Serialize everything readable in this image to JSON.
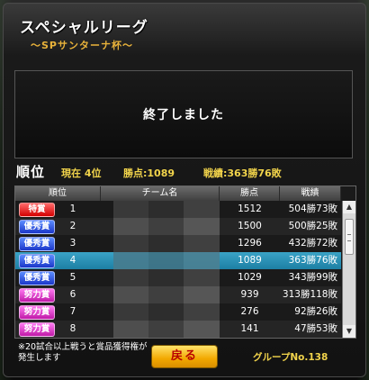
{
  "header": {
    "title": "スペシャルリーグ",
    "subtitle": "～SPサンターナ杯～"
  },
  "status_message": "終了しました",
  "summary": {
    "heading": "順位",
    "current_rank": "現在 4位",
    "points": "勝点:1089",
    "record": "戦績:363勝76敗"
  },
  "table": {
    "headers": [
      "順位",
      "チーム名",
      "勝点",
      "戦績"
    ],
    "rows": [
      {
        "badge": "特賞",
        "tier": "special",
        "rank": "1",
        "team": "",
        "points": "1512",
        "record": "504勝73敗"
      },
      {
        "badge": "優秀賞",
        "tier": "excellent",
        "rank": "2",
        "team": "",
        "points": "1500",
        "record": "500勝25敗"
      },
      {
        "badge": "優秀賞",
        "tier": "excellent",
        "rank": "3",
        "team": "",
        "points": "1296",
        "record": "432勝72敗"
      },
      {
        "badge": "優秀賞",
        "tier": "excellent",
        "rank": "4",
        "team": "",
        "points": "1089",
        "record": "363勝76敗",
        "highlight": true
      },
      {
        "badge": "優秀賞",
        "tier": "excellent",
        "rank": "5",
        "team": "",
        "points": "1029",
        "record": "343勝99敗"
      },
      {
        "badge": "努力賞",
        "tier": "effort",
        "rank": "6",
        "team": "",
        "points": "939",
        "record": "313勝118敗"
      },
      {
        "badge": "努力賞",
        "tier": "effort",
        "rank": "7",
        "team": "",
        "points": "276",
        "record": "92勝26敗"
      },
      {
        "badge": "努力賞",
        "tier": "effort",
        "rank": "8",
        "team": "",
        "points": "141",
        "record": "47勝53敗"
      }
    ]
  },
  "scrollbar": {
    "up_icon": "triangle-up-icon",
    "down_icon": "triangle-down-icon"
  },
  "footer": {
    "note": "※20試合以上戦うと賞品獲得権が発生します",
    "back_label": "戻る",
    "group": "グループNo.138"
  },
  "colors": {
    "accent_yellow": "#f2d44b",
    "highlight_row": "#2a92b8",
    "special": "#d40000",
    "excellent": "#1b36c9",
    "effort": "#c01aa8"
  }
}
